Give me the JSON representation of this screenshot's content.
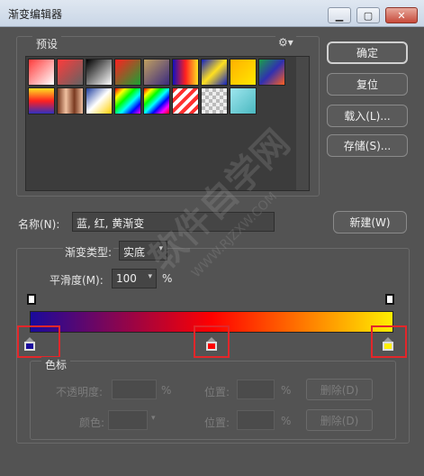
{
  "window": {
    "title": "渐变编辑器"
  },
  "presets": {
    "label": "预设",
    "gear_icon": "gear-icon",
    "swatches": [
      {
        "css": "linear-gradient(135deg,#ff3b3b,#ffffff)"
      },
      {
        "css": "linear-gradient(135deg,#ff3b3b,rgba(255,255,255,0.2))"
      },
      {
        "css": "linear-gradient(135deg,#000000,#ffffff)"
      },
      {
        "css": "linear-gradient(135deg,#ff2020,#19a234)"
      },
      {
        "css": "linear-gradient(135deg,#c0a060,#3a2a80)"
      },
      {
        "css": "linear-gradient(90deg,#1010c0,#ff2020,#ffe020)"
      },
      {
        "css": "linear-gradient(135deg,#1020c0,#ffe020,#1020c0)"
      },
      {
        "css": "linear-gradient(135deg,#ffb000,#ffe800)"
      },
      {
        "css": "linear-gradient(135deg,#1aa04a,#3030b0,#ff6020)"
      },
      {
        "css": "linear-gradient(180deg,#ffe020,#ff2020,#3030c0)"
      },
      {
        "css": "linear-gradient(90deg,#7a3a20,#f0c0a0,#7a3a20,#f0c0a0)"
      },
      {
        "css": "linear-gradient(135deg,#1f3fa0,#ffffff,#ffd000)"
      },
      {
        "css": "linear-gradient(135deg,#ff0000,#ffff00,#00ff00,#00ffff,#0000ff,#ff00ff)"
      },
      {
        "css": "linear-gradient(135deg,#ff0000,#ffff00,#00ff00,#00ffff,#0000ff,#ff00ff,#ff0000)"
      },
      {
        "css": "repeating-linear-gradient(135deg,#ff3030 0 4px,#ffffff 4px 8px)"
      },
      {
        "css": "repeating-conic-gradient(#bbb 0 25%,#eee 0 50%) 0 0/8px 8px"
      },
      {
        "css": "linear-gradient(135deg,#9ee6ee,#4ab8c0)"
      }
    ]
  },
  "buttons": {
    "ok": "确定",
    "reset": "复位",
    "load": "载入(L)...",
    "save": "存储(S)...",
    "new": "新建(W)"
  },
  "name_field": {
    "label": "名称(N):",
    "value": "蓝, 红, 黄渐变"
  },
  "gradient": {
    "type_label": "渐变类型:",
    "type_value": "实底",
    "smooth_label": "平滑度(M):",
    "smooth_value": "100",
    "smooth_unit": "%",
    "stops": [
      {
        "color": "#1a0a9c",
        "location_pct": 0
      },
      {
        "color": "#ff0000",
        "location_pct": 50
      },
      {
        "color": "#ffee00",
        "location_pct": 100
      }
    ]
  },
  "color_stops": {
    "label": "色标",
    "opacity_label": "不透明度:",
    "opacity_unit": "%",
    "position_label": "位置:",
    "position_unit": "%",
    "delete_label": "删除(D)",
    "color_label": "颜色:",
    "position_label2": "位置:",
    "position_unit2": "%",
    "delete_label2": "删除(D)"
  },
  "watermark": {
    "text": "软件自学网",
    "url": "WWW.RJZXW.COM"
  }
}
